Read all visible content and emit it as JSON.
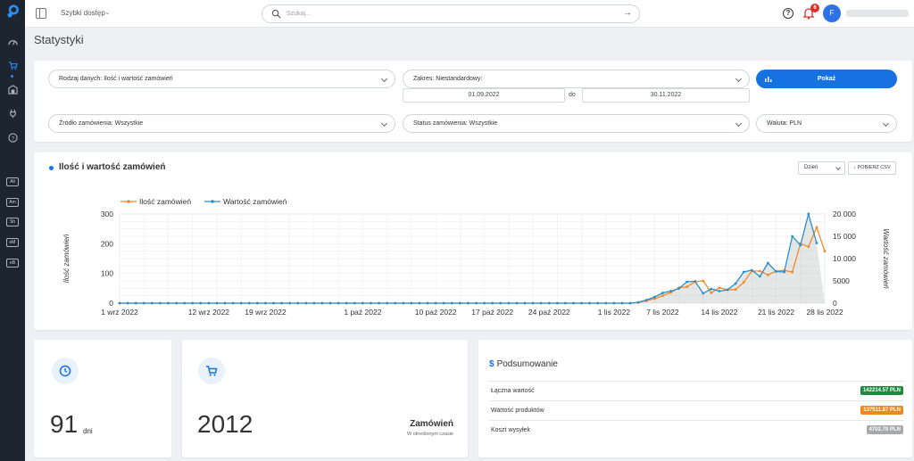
{
  "topbar": {
    "quick_access": "Szybki dostęp",
    "search_placeholder": "Szukaj...",
    "notifications_count": "6",
    "avatar_initial": "F"
  },
  "sidebar": {
    "tags": [
      "All",
      "Am",
      "Sh",
      "eM",
      "eB"
    ]
  },
  "page": {
    "title": "Statystyki"
  },
  "filters": {
    "data_type": "Rodzaj danych: Ilość i wartość zamówień",
    "range": "Zakres: Niestandardowy:",
    "date_from": "01.09.2022",
    "date_sep": "do",
    "date_to": "30.11.2022",
    "show_label": "Pokaż",
    "source": "Źródło zamówienia: Wszystkie",
    "status": "Status zamówienia: Wszystkie",
    "currency": "Waluta: PLN"
  },
  "chart_panel": {
    "title": "Ilość i wartość zamówień",
    "period_select": "Dzień",
    "csv_button": "POBIERZ CSV"
  },
  "chart_data": {
    "type": "line",
    "title": "",
    "series": [
      {
        "name": "Ilość zamówień",
        "axis": "left",
        "color": "#f0892a",
        "values": [
          0,
          0,
          0,
          0,
          0,
          0,
          0,
          0,
          0,
          0,
          0,
          0,
          0,
          0,
          0,
          0,
          0,
          0,
          0,
          0,
          0,
          0,
          0,
          0,
          0,
          0,
          0,
          0,
          0,
          0,
          0,
          0,
          0,
          0,
          0,
          0,
          0,
          0,
          0,
          0,
          0,
          0,
          0,
          0,
          0,
          0,
          0,
          0,
          0,
          0,
          0,
          0,
          0,
          0,
          0,
          0,
          0,
          0,
          0,
          0,
          0,
          0,
          0,
          0,
          2,
          8,
          15,
          25,
          36,
          52,
          55,
          72,
          75,
          35,
          52,
          45,
          46,
          70,
          108,
          108,
          95,
          108,
          110,
          105,
          200,
          190,
          255,
          175
        ]
      },
      {
        "name": "Wartość zamówień",
        "axis": "right",
        "color": "#2a8fc8",
        "values": [
          0,
          0,
          0,
          0,
          0,
          0,
          0,
          0,
          0,
          0,
          0,
          0,
          0,
          0,
          0,
          0,
          0,
          0,
          0,
          0,
          0,
          0,
          0,
          0,
          0,
          0,
          0,
          0,
          0,
          0,
          0,
          0,
          0,
          0,
          0,
          0,
          0,
          0,
          0,
          0,
          0,
          0,
          0,
          0,
          0,
          0,
          0,
          0,
          0,
          0,
          0,
          0,
          0,
          0,
          0,
          0,
          0,
          0,
          0,
          0,
          0,
          0,
          0,
          0,
          200,
          700,
          1400,
          2300,
          2700,
          3300,
          4800,
          4900,
          2200,
          3200,
          2700,
          3000,
          4400,
          7000,
          7400,
          6000,
          9000,
          7100,
          7000,
          15000,
          13000,
          20000,
          13500
        ]
      }
    ],
    "x_labels": [
      "1 wrz 2022",
      "12 wrz 2022",
      "19 wrz 2022",
      "1 paź 2022",
      "10 paź 2022",
      "17 paź 2022",
      "24 paź 2022",
      "1 lis 2022",
      "7 lis 2022",
      "14 lis 2022",
      "21 lis 2022",
      "28 lis 2022"
    ],
    "ylabel_left": "Ilość zamówień",
    "ylabel_right": "Wartość zamówień",
    "ylim_left": [
      0,
      300
    ],
    "ylim_right": [
      0,
      20000
    ],
    "yticks_left": [
      "0",
      "100",
      "200",
      "300"
    ],
    "yticks_right": [
      "0",
      "5000",
      "10 000",
      "15 000",
      "20 000"
    ],
    "legend_position": "top-left"
  },
  "stats": {
    "days_value": "91",
    "days_unit": "dni",
    "orders_value": "2012",
    "orders_label": "Zamówień",
    "orders_sub": "W określonym czasie"
  },
  "summary": {
    "title": "Podsumowanie",
    "rows": [
      {
        "label": "Łączna wartość",
        "value": "142214.57 PLN",
        "color": "#1e8a3f"
      },
      {
        "label": "Wartość produktów",
        "value": "137511.87 PLN",
        "color": "#ee8a1d"
      },
      {
        "label": "Koszt wysyłek",
        "value": "4702.70 PLN",
        "color": "#a7a9ac"
      }
    ]
  }
}
